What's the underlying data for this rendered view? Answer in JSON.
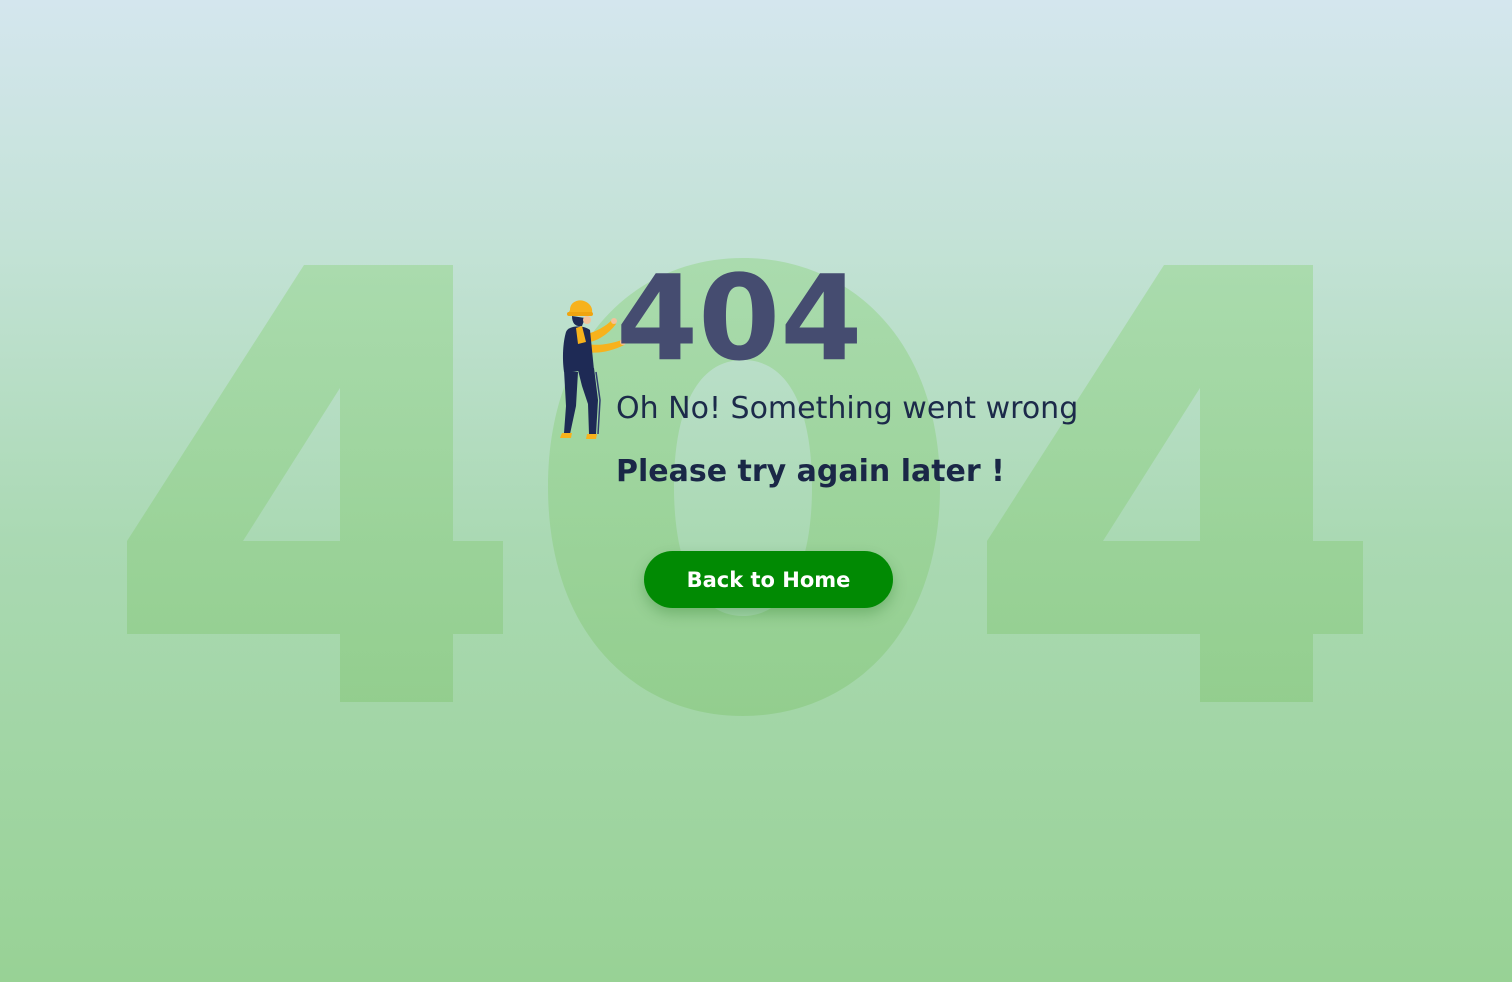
{
  "background": {
    "watermark_text": "404",
    "gradient_top": "#d4e6ee",
    "gradient_bottom": "#98d295",
    "watermark_color": "#8fcc88"
  },
  "illustration": {
    "icon": "construction-worker-icon"
  },
  "error": {
    "code": "404",
    "title": "Oh No! Something went wrong",
    "message": "Please try again later !"
  },
  "actions": {
    "home_label": "Back to Home"
  },
  "colors": {
    "code": "#454c70",
    "text": "#1c2a4a",
    "button_bg": "#018a03",
    "button_text": "#ffffff"
  }
}
